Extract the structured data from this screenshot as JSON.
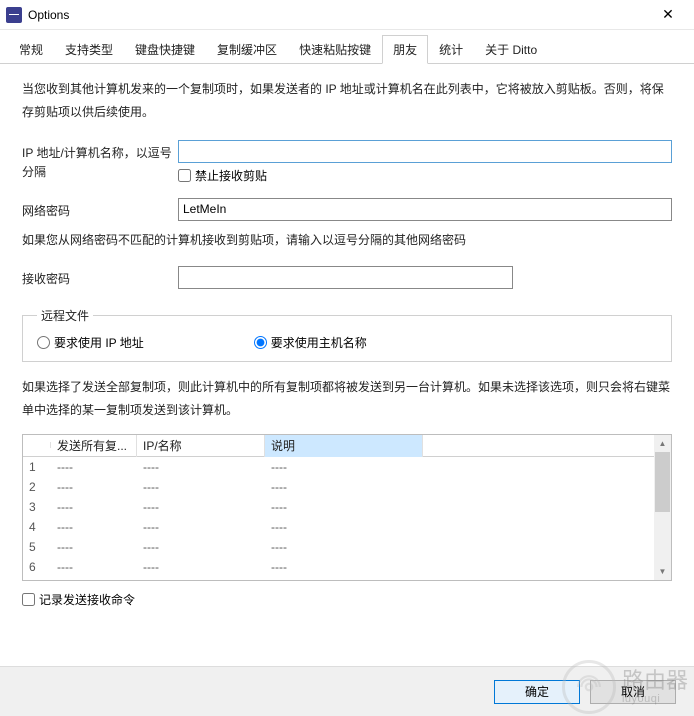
{
  "window": {
    "title": "Options"
  },
  "tabs": {
    "t0": "常规",
    "t1": "支持类型",
    "t2": "键盘快捷键",
    "t3": "复制缓冲区",
    "t4": "快速粘贴按键",
    "t5": "朋友",
    "t6": "统计",
    "t7": "关于 Ditto"
  },
  "intro": "当您收到其他计算机发来的一个复制项时，如果发送者的 IP 地址或计算机名在此列表中，它将被放入剪贴板。否则，将保存剪贴项以供后续使用。",
  "labels": {
    "ip_names": "IP 地址/计算机名称，以逗号分隔",
    "disable_recv": "禁止接收剪贴",
    "net_pwd": "网络密码",
    "net_pwd_hint": "如果您从网络密码不匹配的计算机接收到剪贴项，请输入以逗号分隔的其他网络密码",
    "recv_pwd": "接收密码"
  },
  "values": {
    "ip_names": "",
    "net_pwd": "LetMeIn",
    "recv_pwd": ""
  },
  "remote": {
    "legend": "远程文件",
    "r_ip": "要求使用 IP 地址",
    "r_host": "要求使用主机名称"
  },
  "send_desc": "如果选择了发送全部复制项，则此计算机中的所有复制项都将被发送到另一台计算机。如果未选择该选项，则只会将右键菜单中选择的某一复制项发送到该计算机。",
  "grid": {
    "cols": {
      "send": "发送所有复...",
      "ip": "IP/名称",
      "desc": "说明"
    },
    "empty": "----",
    "rows": [
      "1",
      "2",
      "3",
      "4",
      "5",
      "6"
    ]
  },
  "log_checkbox": "记录发送接收命令",
  "buttons": {
    "ok": "确定",
    "cancel": "取消"
  },
  "watermark": {
    "big": "路由器",
    "small": "luyouqi"
  }
}
